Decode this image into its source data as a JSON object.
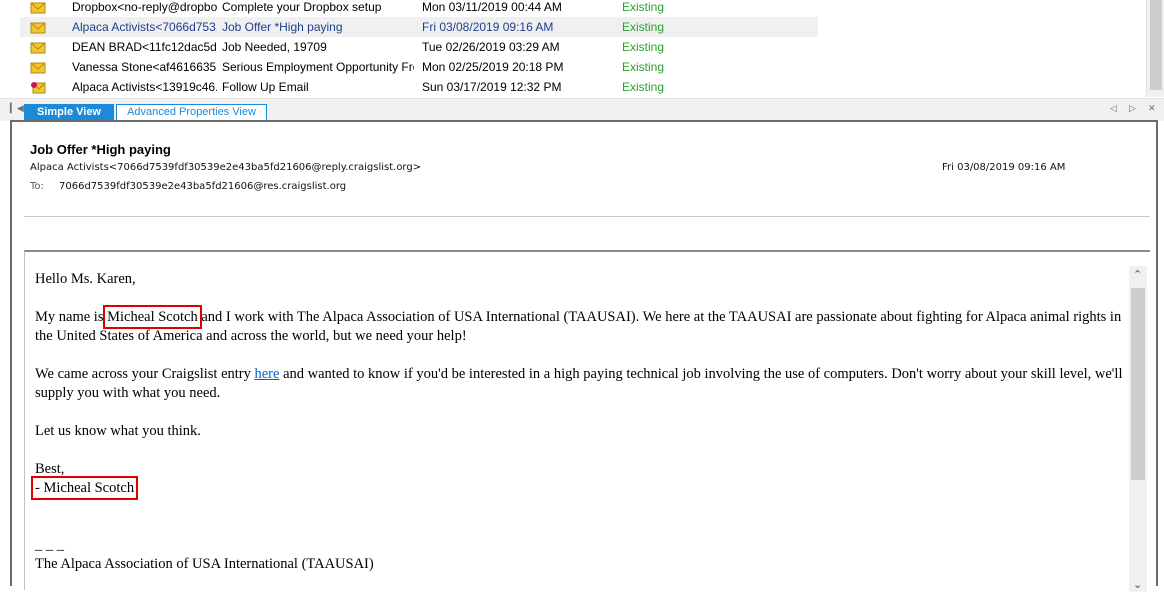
{
  "messages": [
    {
      "from": "Dropbox<no-reply@dropbox...",
      "subject": "Complete your Dropbox setup",
      "date": "Mon 03/11/2019 00:44 AM",
      "status": "Existing"
    },
    {
      "from": "Alpaca Activists<7066d753...",
      "subject": "Job Offer *High paying",
      "date": "Fri 03/08/2019 09:16 AM",
      "status": "Existing"
    },
    {
      "from": "DEAN BRAD<11fc12dac5d...",
      "subject": "Job Needed, 19709",
      "date": "Tue 02/26/2019 03:29 AM",
      "status": "Existing"
    },
    {
      "from": "Vanessa Stone<af4616635...",
      "subject": "Serious Employment Opportunity From ...",
      "date": "Mon 02/25/2019 20:18 PM",
      "status": "Existing"
    },
    {
      "from": "Alpaca Activists<13919c46...",
      "subject": "Follow Up Email",
      "date": "Sun 03/17/2019 12:32 PM",
      "status": "Existing"
    }
  ],
  "tabs": {
    "simple": "Simple View",
    "advanced": "Advanced Properties View"
  },
  "email": {
    "subject": "Job Offer *High paying",
    "from": "Alpaca Activists<7066d7539fdf30539e2e43ba5fd21606@reply.craigslist.org>",
    "date": "Fri 03/08/2019 09:16 AM",
    "to_label": "To:",
    "to": "7066d7539fdf30539e2e43ba5fd21606@res.craigslist.org",
    "greeting": "Hello Ms. Karen,",
    "p1_a": "My name is ",
    "sender_name": "Micheal Scotch",
    "p1_b": " and I work with The Alpaca Association of USA International (TAAUSAI). We here at the TAAUSAI are passionate about fighting for Alpaca animal rights in the United States of America and across the world, but we need your help!",
    "p2_a": "We came across your Craigslist entry ",
    "p2_link": "here",
    "p2_b": " and wanted to know if you'd be interested in a high paying technical job involving the use of computers. Don't worry about your skill level, we'll supply you with what you need.",
    "p3": "Let us know what you think.",
    "closing": "Best,",
    "signature_prefix": "- ",
    "signature_name": "Micheal Scotch",
    "dashes": "_ _ _",
    "org": "The Alpaca Association of USA International (TAAUSAI)"
  },
  "colors": {
    "accent": "#1c8ad8",
    "status": "#2ca02c",
    "highlight": "#e00000",
    "link": "#0563c1"
  }
}
